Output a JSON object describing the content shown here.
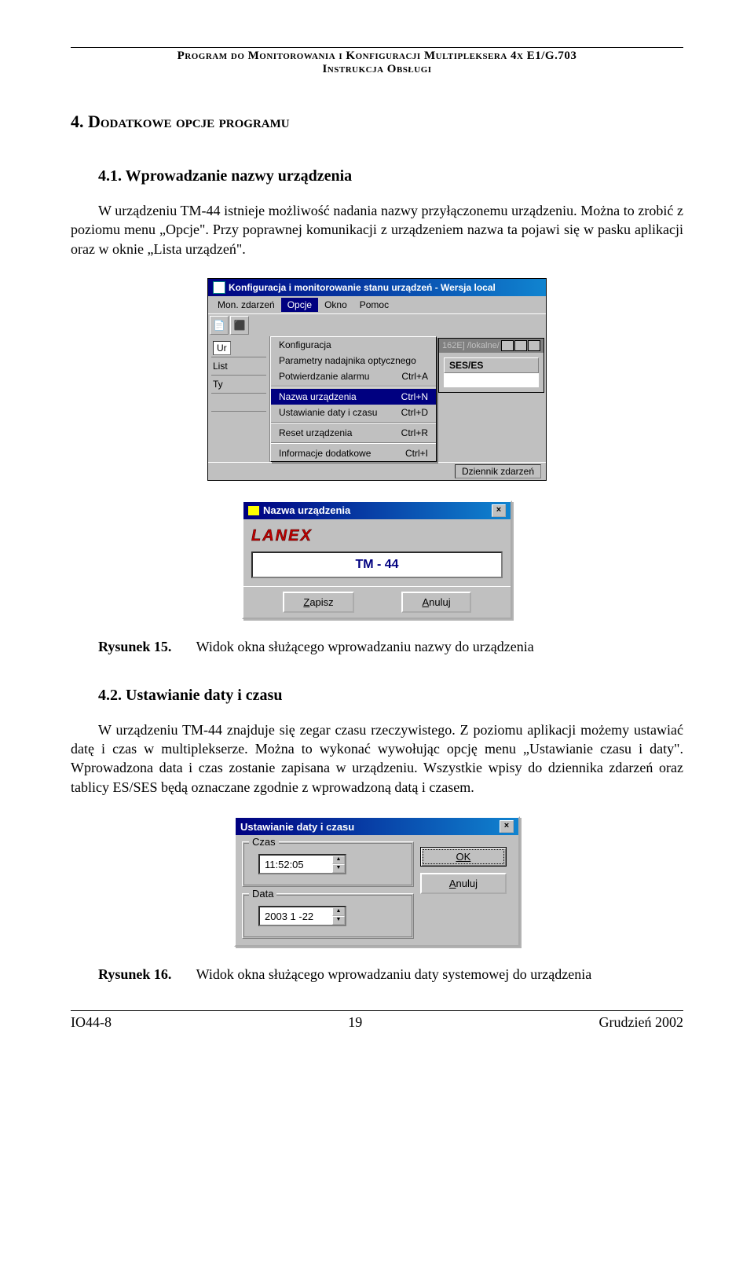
{
  "header": {
    "line1": "Program do Monitorowania i Konfiguracji Multipleksera 4x E1/G.703",
    "line2": "Instrukcja Obsługi"
  },
  "section": {
    "title": "4. Dodatkowe opcje programu"
  },
  "sub1": {
    "title": "4.1. Wprowadzanie nazwy urządzenia",
    "para": "W urządzeniu TM-44 istnieje możliwość nadania nazwy przyłączonemu urządzeniu. Można to zrobić z poziomu menu „Opcje\". Przy poprawnej komunikacji z urządzeniem nazwa ta pojawi się w pasku aplikacji oraz w oknie „Lista urządzeń\"."
  },
  "fig1": {
    "window_title": "Konfiguracja i monitorowanie stanu urządzeń  - Wersja local",
    "menu": [
      "Mon. zdarzeń",
      "Opcje",
      "Okno",
      "Pomoc"
    ],
    "active_menu": "Opcje",
    "dropdown": [
      {
        "label": "Konfiguracja",
        "shortcut": ""
      },
      {
        "label": "Parametry nadajnika optycznego",
        "shortcut": ""
      },
      {
        "label": "Potwierdzanie alarmu",
        "shortcut": "Ctrl+A"
      },
      {
        "sep": true
      },
      {
        "label": "Nazwa urządzenia",
        "shortcut": "Ctrl+N",
        "selected": true
      },
      {
        "label": "Ustawianie daty i czasu",
        "shortcut": "Ctrl+D"
      },
      {
        "sep": true
      },
      {
        "label": "Reset urządzenia",
        "shortcut": "Ctrl+R"
      },
      {
        "sep": true
      },
      {
        "label": "Informacje dodatkowe",
        "shortcut": "Ctrl+I"
      }
    ],
    "left_labels": [
      "Ur",
      "List",
      "Ty"
    ],
    "inner_title": "162E] /lokalne/",
    "table_header": "SES/ES",
    "status": "Dziennik zdarzeń"
  },
  "fig2": {
    "title": "Nazwa urządzenia",
    "logo": "LANEX",
    "value": "TM - 44",
    "save": "Zapisz",
    "cancel": "Anuluj"
  },
  "caption1": {
    "label": "Rysunek 15.",
    "text": "Widok okna służącego wprowadzaniu nazwy do urządzenia"
  },
  "sub2": {
    "title": "4.2. Ustawianie daty i czasu",
    "para": "W urządzeniu TM-44 znajduje się zegar czasu rzeczywistego. Z poziomu aplikacji możemy ustawiać datę i czas w multiplekserze. Można to wykonać wywołując opcję menu „Ustawianie czasu i daty\". Wprowadzona data i czas zostanie zapisana w urządzeniu. Wszystkie wpisy do dziennika zdarzeń oraz tablicy ES/SES będą oznaczane zgodnie z wprowadzoną datą i czasem."
  },
  "fig3": {
    "title": "Ustawianie daty i czasu",
    "group_time": "Czas",
    "time_value": "11:52:05",
    "group_date": "Data",
    "date_value": "2003 1 -22",
    "ok": "OK",
    "cancel": "Anuluj"
  },
  "caption2": {
    "label": "Rysunek 16.",
    "text": "Widok okna służącego wprowadzaniu daty systemowej do urządzenia"
  },
  "footer": {
    "left": "IO44-8",
    "center": "19",
    "right": "Grudzień 2002"
  }
}
